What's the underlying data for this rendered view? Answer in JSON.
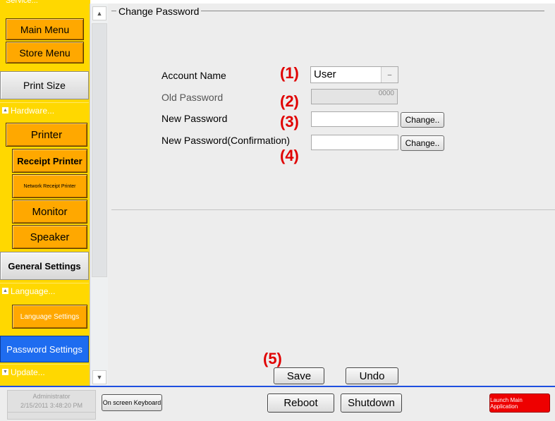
{
  "sidebar": {
    "partial_top_label": "Service...",
    "main_menu": "Main Menu",
    "store_menu": "Store Menu",
    "print_size": "Print Size",
    "hardware_header": "Hardware...",
    "printer": "Printer",
    "receipt_printer": "Receipt Printer",
    "network_receipt_printer": "Network Receipt Printer",
    "monitor": "Monitor",
    "speaker": "Speaker",
    "general_settings": "General Settings",
    "language_header": "Language...",
    "language_settings": "Language Settings",
    "password_settings": "Password Settings",
    "update_header": "Update..."
  },
  "main": {
    "group_title": "Change Password",
    "account_name_label": "Account Name",
    "account_name_value": "User",
    "old_password_label": "Old Password",
    "old_password_value": "0000",
    "new_password_label": "New Password",
    "new_password_confirm_label": "New Password(Confirmation)",
    "change_label": "Change..",
    "save_label": "Save",
    "undo_label": "Undo",
    "markers": [
      "(1)",
      "(2)",
      "(3)",
      "(4)",
      "(5)"
    ]
  },
  "bottombar": {
    "user": "Administrator",
    "datetime": "2/15/2011 3:48:20 PM",
    "keyboard_label": "On screen Keyboard",
    "reboot_label": "Reboot",
    "shutdown_label": "Shutdown",
    "launch_label": "Launch Main Application"
  },
  "colors": {
    "sidebar_yellow": "#ffd800",
    "button_orange": "#ffa800",
    "selected_blue": "#1e6cf0",
    "marker_red": "#e00000",
    "launch_red": "#ee0000"
  },
  "icons": {
    "scroll_up": "chevron-up-icon",
    "scroll_down": "chevron-down-icon",
    "dropdown": "chevron-down-icon"
  }
}
